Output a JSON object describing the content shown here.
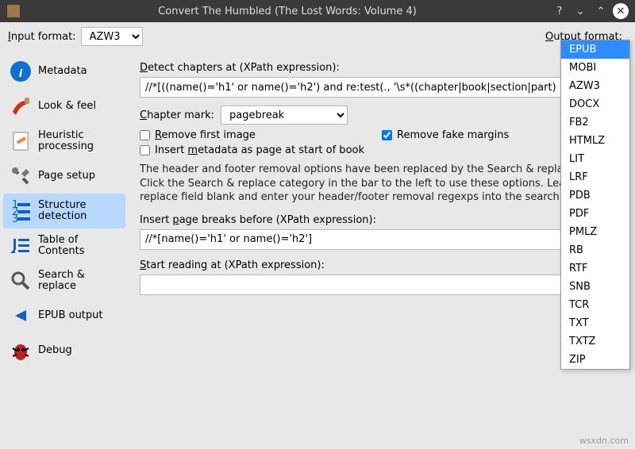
{
  "window": {
    "title": "Convert The Humbled (The Lost Words: Volume 4)"
  },
  "topbar": {
    "input_label_pre": "I",
    "input_label_post": "nput format:",
    "input_value": "AZW3",
    "output_label_pre": "O",
    "output_label_post": "utput format:"
  },
  "sidebar": {
    "items": [
      {
        "label": "Metadata"
      },
      {
        "label": "Look & feel"
      },
      {
        "label": "Heuristic processing"
      },
      {
        "label": "Page setup"
      },
      {
        "label": "Structure detection"
      },
      {
        "label": "Table of Contents"
      },
      {
        "label": "Search & replace"
      },
      {
        "label": "EPUB output"
      },
      {
        "label": "Debug"
      }
    ]
  },
  "content": {
    "detect_label_pre": "D",
    "detect_label_post": "etect chapters at (XPath expression):",
    "detect_value": "//*[((name()='h1' or name()='h2') and re:test(., '\\s*((chapter|book|section|part)",
    "chapter_mark_label_pre": "C",
    "chapter_mark_label_post": "hapter mark:",
    "chapter_mark_value": "pagebreak",
    "remove_first_pre": "R",
    "remove_first_post": "emove first image",
    "remove_fake": "Remove fake margins",
    "insert_meta_pre": "Insert ",
    "insert_meta_u": "m",
    "insert_meta_post": "etadata as page at start of book",
    "help_text": "The header and footer removal options have been replaced by the Search & replace options. Click the Search & replace category in the bar to the left to use these options. Leave the replace field blank and enter your header/footer removal regexps into the search field.",
    "insert_page_label_pre": "Insert ",
    "insert_page_label_u": "p",
    "insert_page_label_post": "age breaks before (XPath expression):",
    "insert_page_value": "//*[name()='h1' or name()='h2']",
    "start_reading_label_pre": "S",
    "start_reading_label_post": "tart reading at (XPath expression):",
    "start_reading_value": ""
  },
  "output_dropdown": {
    "options": [
      "EPUB",
      "MOBI",
      "AZW3",
      "DOCX",
      "FB2",
      "HTMLZ",
      "LIT",
      "LRF",
      "PDB",
      "PDF",
      "PMLZ",
      "RB",
      "RTF",
      "SNB",
      "TCR",
      "TXT",
      "TXTZ",
      "ZIP"
    ],
    "selected": "EPUB"
  },
  "watermark": "wsxdn.com"
}
